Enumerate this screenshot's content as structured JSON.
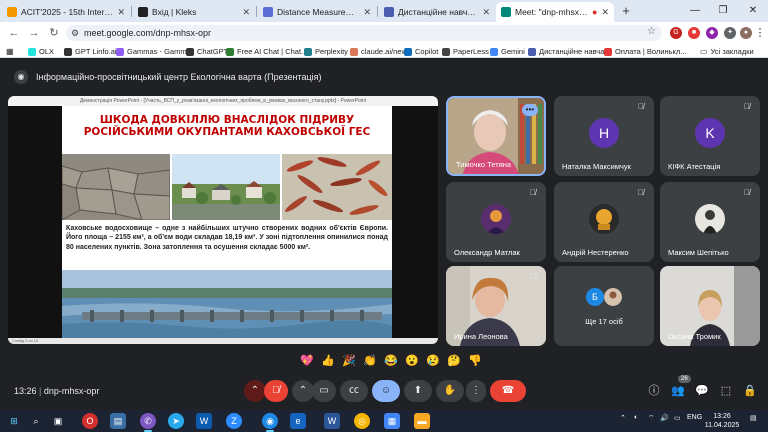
{
  "browser": {
    "tabs": [
      {
        "title": "ACIT'2025 - 15th International C",
        "color": "#f29900",
        "active": false
      },
      {
        "title": "Вхід | Kleks",
        "color": "#222222",
        "active": false
      },
      {
        "title": "Distance Measurement using A",
        "color": "#5b6dd4",
        "active": false
      },
      {
        "title": "Дистанційне навчання в ВСП",
        "color": "#4a5db0",
        "active": false
      },
      {
        "title": "Meet: \"dnp-mhsx-opr\"",
        "color": "#00897b",
        "active": true
      }
    ],
    "new_tab": "+",
    "url": "meet.google.com/dnp-mhsx-opr",
    "bookmarks": [
      {
        "label": "OLX",
        "color": "#23e5db"
      },
      {
        "label": "GPT Linfo.ai",
        "color": "#333333"
      },
      {
        "label": "Gammas - Gamma",
        "color": "#8d5cf6"
      },
      {
        "label": "ChatGPT",
        "color": "#333333"
      },
      {
        "label": "Free AI Chat | Chat...",
        "color": "#2e7d32"
      },
      {
        "label": "Perplexity",
        "color": "#20808d"
      },
      {
        "label": "claude.ai/new",
        "color": "#d97757"
      },
      {
        "label": "Copilot",
        "color": "#0f6cbd"
      },
      {
        "label": "PaperLess",
        "color": "#444444"
      },
      {
        "label": "Gemini",
        "color": "#4285f4"
      },
      {
        "label": "Дистанційне навча...",
        "color": "#4a5db0"
      },
      {
        "label": "Оплата | Волинькл...",
        "color": "#e53935"
      }
    ],
    "all_bookmarks": "Усі закладки"
  },
  "meet": {
    "title": "Інформаційно-просвітницький центр Екологічна варта (Презентація)",
    "ppt_titlebar": "Демонстрація PowerPoint - [Участь_ВСП_у_розв'язанні_екологічних_проблем_в_умовах_воєнного_стану.pptx] - PowerPoint",
    "ppt_status": "Слайд 5 из 15",
    "slide": {
      "title": "ШКОДА ДОВКІЛЛЮ ВНАСЛІДОК ПІДРИВУ РОСІЙСЬКИМИ ОКУПАНТАМИ КАХОВСЬКОЇ ГЕС",
      "body": "Каховське водосховище – одне з найбільших штучно створених водних об'єктів Європи. Його площа – 2155 км², а об'єм води складав 18,19 км³. У зоні підтоплення опинилися понад 80 населених пунктів. Зона затоплення та осушення складає 5000 км²."
    },
    "participants": [
      {
        "name": "Тимочко Тетяна"
      },
      {
        "name": "Наталка Максимчук",
        "initial": "Н",
        "color": "#5e35b1"
      },
      {
        "name": "КІФК Атестація",
        "initial": "K",
        "color": "#5e35b1"
      },
      {
        "name": "Олександр Матлак"
      },
      {
        "name": "Андрій Нестеренко"
      },
      {
        "name": "Максим Шепітько"
      },
      {
        "name": "Ирина Леонова"
      },
      {
        "name": "Ще 17 осіб",
        "initial": "Б"
      },
      {
        "name": "Оксана Тромик"
      }
    ],
    "reactions": [
      "💖",
      "👍",
      "🎉",
      "👏",
      "😂",
      "😮",
      "😢",
      "🤔",
      "👎"
    ],
    "time": "13:26",
    "code": "dnp-mhsx-opr",
    "people_count": "26"
  },
  "taskbar": {
    "lang": "ENG",
    "time": "13:26",
    "date": "11.04.2025"
  }
}
